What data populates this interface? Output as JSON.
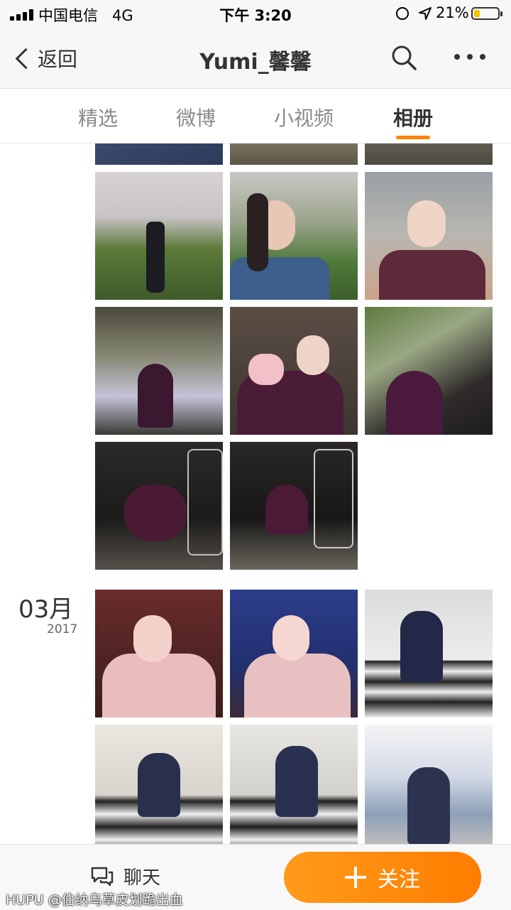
{
  "status_bar": {
    "carrier": "中国电信",
    "network": "4G",
    "time": "下午 3:20",
    "battery_percent": "21%",
    "battery_level": 0.21,
    "battery_color": "#f5c400"
  },
  "nav": {
    "back_label": "返回",
    "title": "Yumi_馨馨"
  },
  "tabs": [
    {
      "label": "精选",
      "active": false
    },
    {
      "label": "微博",
      "active": false
    },
    {
      "label": "小视频",
      "active": false
    },
    {
      "label": "相册",
      "active": true
    }
  ],
  "album": {
    "group_month": "03月",
    "group_year": "2017"
  },
  "bottom_bar": {
    "chat_label": "聊天",
    "follow_label": "关注"
  },
  "watermark": "HUPU @伯纳乌草皮划跪出血",
  "colors": {
    "accent": "#ff8200",
    "follow_gradient_start": "#ff9a1a",
    "follow_gradient_end": "#ff7d00"
  }
}
